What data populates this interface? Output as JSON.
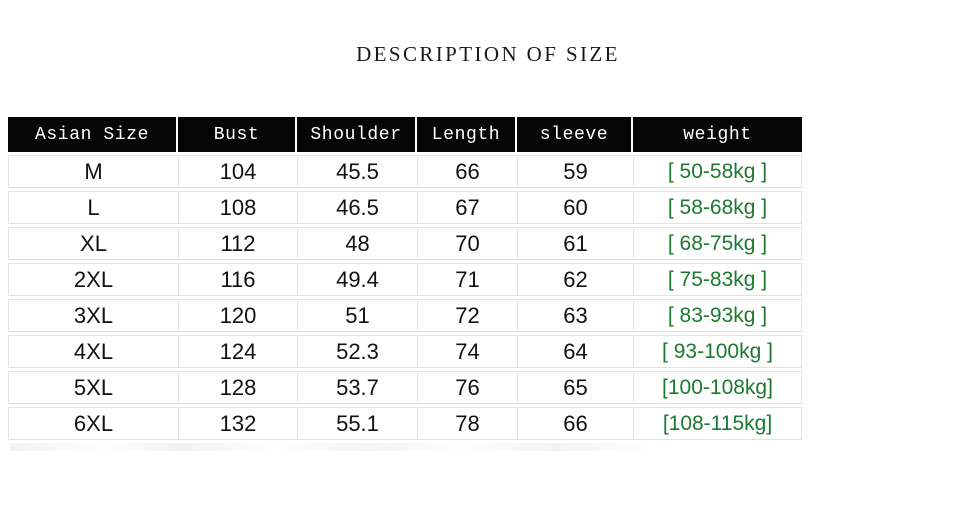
{
  "title": "DESCRIPTION OF SIZE",
  "colors": {
    "header_background": "#060606",
    "header_text": "#ffffff",
    "cell_text": "#111111",
    "weight_text": "#1b7a30",
    "cell_border": "#e2e2e2",
    "page_background": "#ffffff"
  },
  "table": {
    "headers": [
      "Asian Size",
      "Bust",
      "Shoulder",
      "Length",
      "sleeve",
      "weight"
    ],
    "rows": [
      {
        "size": "M",
        "bust": "104",
        "shoulder": "45.5",
        "length": "66",
        "sleeve": "59",
        "weight": "[ 50-58kg ]"
      },
      {
        "size": "L",
        "bust": "108",
        "shoulder": "46.5",
        "length": "67",
        "sleeve": "60",
        "weight": "[ 58-68kg ]"
      },
      {
        "size": "XL",
        "bust": "112",
        "shoulder": "48",
        "length": "70",
        "sleeve": "61",
        "weight": "[ 68-75kg ]"
      },
      {
        "size": "2XL",
        "bust": "116",
        "shoulder": "49.4",
        "length": "71",
        "sleeve": "62",
        "weight": "[ 75-83kg ]"
      },
      {
        "size": "3XL",
        "bust": "120",
        "shoulder": "51",
        "length": "72",
        "sleeve": "63",
        "weight": "[ 83-93kg ]"
      },
      {
        "size": "4XL",
        "bust": "124",
        "shoulder": "52.3",
        "length": "74",
        "sleeve": "64",
        "weight": "[ 93-100kg ]"
      },
      {
        "size": "5XL",
        "bust": "128",
        "shoulder": "53.7",
        "length": "76",
        "sleeve": "65",
        "weight": "[100-108kg]"
      },
      {
        "size": "6XL",
        "bust": "132",
        "shoulder": "55.1",
        "length": "78",
        "sleeve": "66",
        "weight": "[108-115kg]"
      }
    ]
  }
}
